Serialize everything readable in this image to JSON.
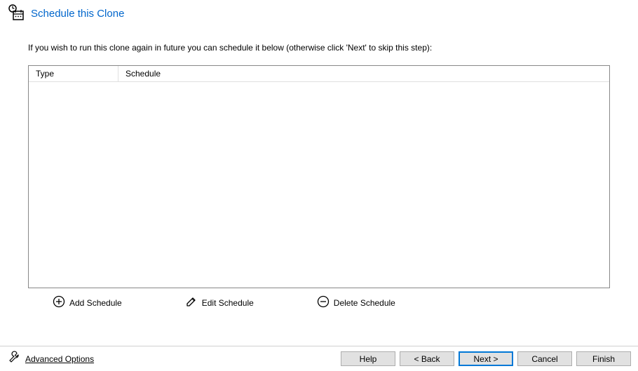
{
  "header": {
    "title": "Schedule this Clone"
  },
  "instruction": "If you wish to run this clone again in future you can schedule it below (otherwise click 'Next' to skip this step):",
  "table": {
    "columns": {
      "type": "Type",
      "schedule": "Schedule"
    },
    "rows": []
  },
  "actions": {
    "add": "Add Schedule",
    "edit": "Edit Schedule",
    "delete": "Delete Schedule"
  },
  "footer": {
    "advanced": "Advanced Options",
    "help": "Help",
    "back": "< Back",
    "next": "Next >",
    "cancel": "Cancel",
    "finish": "Finish"
  }
}
